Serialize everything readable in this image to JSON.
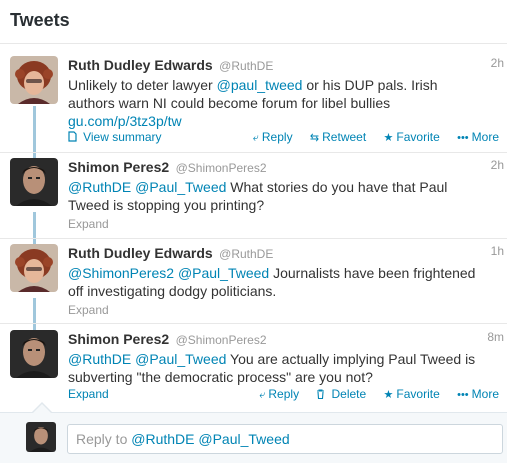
{
  "header": {
    "title": "Tweets"
  },
  "tweets": [
    {
      "fullname": "Ruth Dudley Edwards",
      "handle": "@RuthDE",
      "time": "2h",
      "text": [
        {
          "t": "Unlikely to deter lawyer ",
          "link": false
        },
        {
          "t": "@paul_tweed",
          "link": true
        },
        {
          "t": " or his DUP pals. Irish authors warn NI could become forum for libel bullies ",
          "link": false
        },
        {
          "t": "gu.com/p/3tz3p/tw",
          "link": true
        }
      ],
      "left_action": "View summary",
      "actions": [
        "Reply",
        "Retweet",
        "Favorite",
        "More"
      ]
    },
    {
      "fullname": "Shimon Peres2",
      "handle": "@ShimonPeres2",
      "time": "2h",
      "text": [
        {
          "t": "@RuthDE",
          "link": true
        },
        {
          "t": " ",
          "link": false
        },
        {
          "t": "@Paul_Tweed",
          "link": true
        },
        {
          "t": " What stories do you have that Paul Tweed is stopping you printing?",
          "link": false
        }
      ],
      "left_action": "Expand"
    },
    {
      "fullname": "Ruth Dudley Edwards",
      "handle": "@RuthDE",
      "time": "1h",
      "text": [
        {
          "t": "@ShimonPeres2",
          "link": true
        },
        {
          "t": " ",
          "link": false
        },
        {
          "t": "@Paul_Tweed",
          "link": true
        },
        {
          "t": " Journalists have been frightened off investigating dodgy politicians.",
          "link": false
        }
      ],
      "left_action": "Expand"
    },
    {
      "fullname": "Shimon Peres2",
      "handle": "@ShimonPeres2",
      "time": "8m",
      "text": [
        {
          "t": "@RuthDE",
          "link": true
        },
        {
          "t": " ",
          "link": false
        },
        {
          "t": "@Paul_Tweed",
          "link": true
        },
        {
          "t": " You are actually implying Paul Tweed is subverting \"the democratic process\" are you not?",
          "link": false
        }
      ],
      "left_action": "Expand",
      "actions": [
        "Reply",
        "Delete",
        "Favorite",
        "More"
      ]
    }
  ],
  "reply_box": {
    "prefix": "Reply to ",
    "mentions": [
      "@RuthDE",
      "@Paul_Tweed"
    ]
  },
  "colors": {
    "link": "#0084b4",
    "connector": "#a0c7dc",
    "muted": "#999999"
  },
  "icons": {
    "view_summary": "document-icon",
    "reply": "reply-arrow-icon",
    "retweet": "retweet-icon",
    "favorite": "star-icon",
    "more": "ellipsis-icon",
    "delete": "trash-icon"
  }
}
